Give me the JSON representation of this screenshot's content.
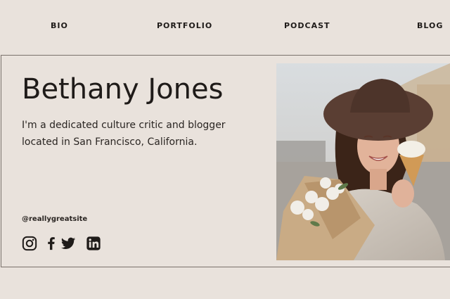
{
  "nav": {
    "items": [
      {
        "label": "BIO"
      },
      {
        "label": "PORTFOLIO"
      },
      {
        "label": "PODCAST"
      },
      {
        "label": "BLOG"
      }
    ]
  },
  "profile": {
    "name": "Bethany Jones",
    "intro": "I'm a dedicated culture critic and blogger located in San Francisco, California.",
    "handle": "@reallygreatsite"
  },
  "social": {
    "icons": [
      "instagram-icon",
      "facebook-icon",
      "twitter-icon",
      "linkedin-icon"
    ]
  },
  "colors": {
    "background": "#e9e2dc",
    "text": "#1f1b19",
    "border": "#7a716b"
  }
}
